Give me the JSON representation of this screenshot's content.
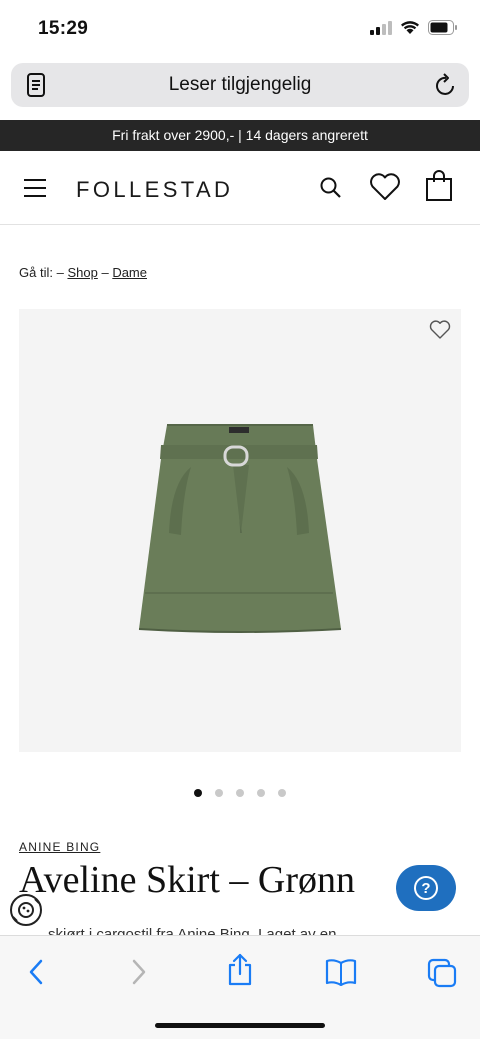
{
  "status_bar": {
    "time": "15:29"
  },
  "browser": {
    "address_text": "Leser tilgjengelig"
  },
  "promo": {
    "text": "Fri frakt over 2900,- | 14 dagers angrerett"
  },
  "header": {
    "logo": "FOLLESTAD"
  },
  "breadcrumb": {
    "prefix": "Gå til:",
    "separator": "–",
    "items": [
      {
        "label": "Shop"
      },
      {
        "label": "Dame"
      }
    ]
  },
  "carousel": {
    "count": 5,
    "active_index": 0
  },
  "product": {
    "brand": "ANINE BING",
    "title": "Aveline Skirt – Grønn",
    "description_snippet": "skjørt i cargostil fra Anine Bing. Laget av en",
    "image_alt": "Green paperbag cargo mini skirt with belt"
  },
  "help_button": {
    "label": "?"
  },
  "colors": {
    "promo_bg": "#262626",
    "accent_blue": "#1f6fbf",
    "skirt_green": "#667a56",
    "ios_blue": "#1a7cf5"
  },
  "icons": {
    "reader": "reader-icon",
    "reload": "reload-icon",
    "menu": "hamburger-menu-icon",
    "search": "search-icon",
    "heart": "heart-icon",
    "bag": "shopping-bag-icon",
    "back": "back-arrow-icon",
    "forward": "forward-arrow-icon",
    "share": "share-icon",
    "bookmarks": "bookmarks-icon",
    "tabs": "tabs-icon"
  }
}
